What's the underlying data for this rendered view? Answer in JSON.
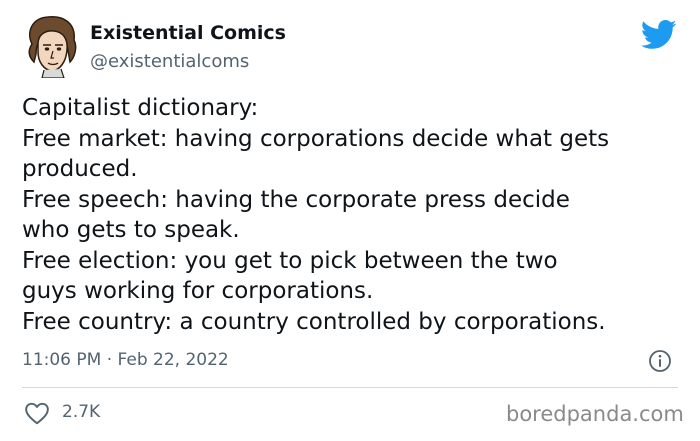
{
  "author": {
    "name": "Existential Comics",
    "handle": "@existentialcoms"
  },
  "tweet": {
    "lines": [
      "Capitalist dictionary:",
      "Free market: having corporations decide what gets",
      "produced.",
      "Free speech: having the corporate press decide",
      "who gets to speak.",
      "Free election: you get to pick between the two",
      "guys working for corporations.",
      "Free country: a country controlled by corporations."
    ],
    "timestamp": "11:06 PM · Feb 22, 2022",
    "likes": "2.7K"
  },
  "watermark": "boredpanda.com",
  "icons": {
    "brand": "twitter-bird-icon",
    "info": "info-icon",
    "like": "heart-icon"
  },
  "colors": {
    "twitter_blue": "#1d9bf0",
    "text": "#0f1419",
    "secondary": "#536471",
    "divider": "#cfd9de"
  }
}
